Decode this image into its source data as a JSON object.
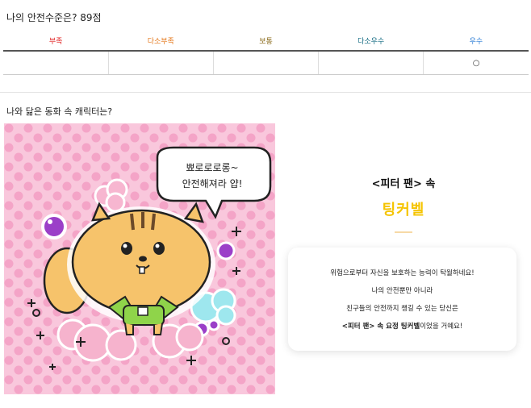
{
  "result": {
    "score_text": "나의 안전수준은? 89점",
    "levels": [
      {
        "label": "부족",
        "color": "#e02424"
      },
      {
        "label": "다소부족",
        "color": "#e57a1f"
      },
      {
        "label": "보통",
        "color": "#8a6a1a"
      },
      {
        "label": "다소우수",
        "color": "#1a6f86"
      },
      {
        "label": "우수",
        "color": "#2f7fd6"
      }
    ],
    "marks": [
      "",
      "",
      "",
      "",
      "○"
    ]
  },
  "character": {
    "question": "나와 닮은 동화 속 캐릭터는?",
    "speech_line1": "뾰로로로롱~",
    "speech_line2": "안전해져라 얍!",
    "story_title": "<피터 팬> 속",
    "name": "팅커벨",
    "desc": {
      "line1": "위험으로부터 자신을 보호하는 능력이 탁월하네요!",
      "line2": "나의 안전뿐만 아니라",
      "line3": "친구들의 안전까지 챙길 수 있는 당신은",
      "line4_bold": "<피터 팬> 속 요정 팅커벨",
      "line4_tail": "이었을 거예요!"
    },
    "colors": {
      "background_pink": "#f9c7dc",
      "dot_pink": "#f4a4c7",
      "name_yellow": "#f5c400",
      "body_orange": "#f6c36b",
      "leaf_green": "#8fd44a"
    }
  }
}
